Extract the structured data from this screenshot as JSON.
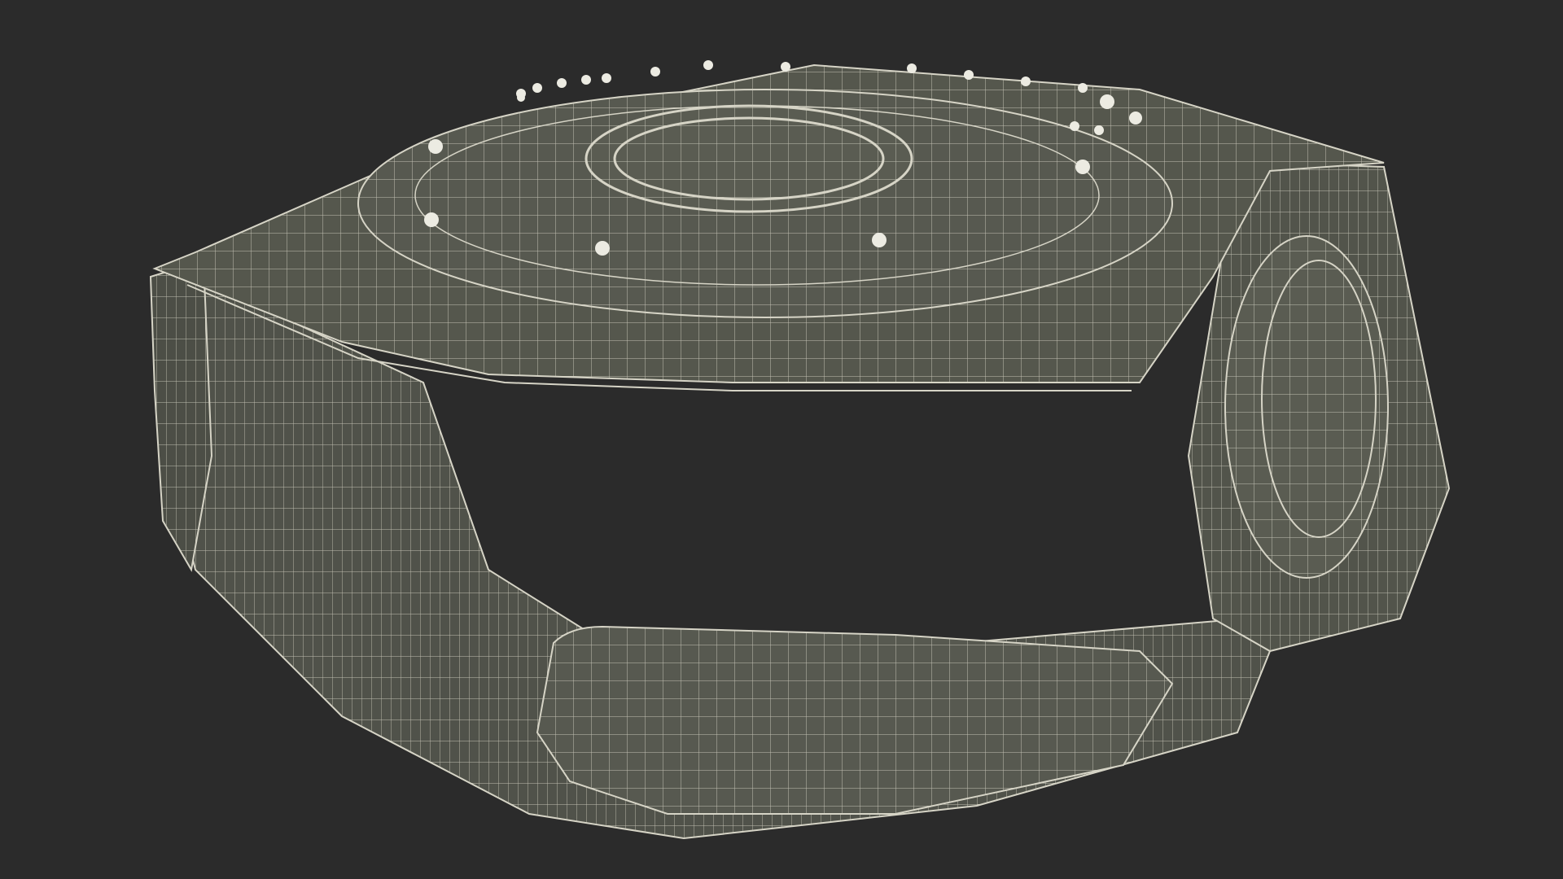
{
  "scene": {
    "subject": "wireframe-bracelet-render",
    "background_color": "#2b2b2b",
    "surface_color": "#55574d",
    "surface_shade_color": "#4a4c44",
    "wire_color": "#d6d4c6",
    "gem_color": "#ecebe2"
  }
}
